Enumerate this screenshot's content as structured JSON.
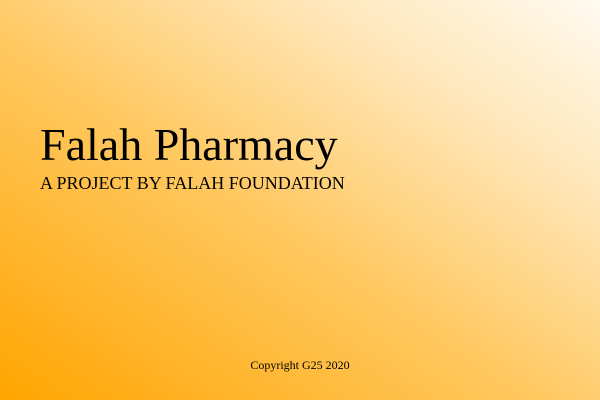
{
  "splash": {
    "title": "Falah Pharmacy",
    "subtitle": "A PROJECT BY FALAH FOUNDATION",
    "copyright": "Copyright G25 2020"
  },
  "colors": {
    "gradient_start": "#ffa500",
    "gradient_end": "#fffaf0",
    "text": "#000000"
  }
}
